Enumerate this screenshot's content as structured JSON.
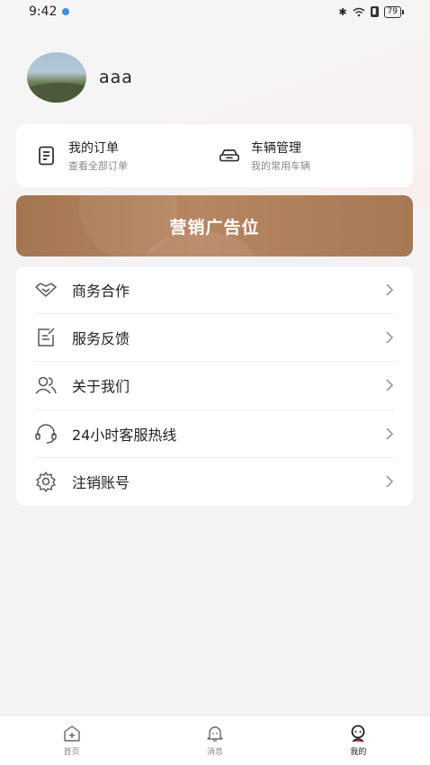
{
  "status_bar": {
    "time": "9:42",
    "battery": "79"
  },
  "profile": {
    "username": "aaa"
  },
  "quick_actions": [
    {
      "title": "我的订单",
      "subtitle": "查看全部订单",
      "icon": "order-list-icon"
    },
    {
      "title": "车辆管理",
      "subtitle": "我的常用车辆",
      "icon": "car-icon"
    }
  ],
  "banner": {
    "text": "营销广告位"
  },
  "menu": [
    {
      "label": "商务合作",
      "icon": "handshake-icon"
    },
    {
      "label": "服务反馈",
      "icon": "feedback-icon"
    },
    {
      "label": "关于我们",
      "icon": "users-icon"
    },
    {
      "label": "24小时客服热线",
      "icon": "headset-icon"
    },
    {
      "label": "注销账号",
      "icon": "gear-icon"
    }
  ],
  "tabbar": [
    {
      "label": "首页",
      "icon": "home-icon",
      "active": false
    },
    {
      "label": "消息",
      "icon": "bell-icon",
      "active": false
    },
    {
      "label": "我的",
      "icon": "profile-icon",
      "active": true
    }
  ],
  "colors": {
    "banner": "#a67854",
    "background": "#f3f3f4",
    "card": "#ffffff"
  }
}
